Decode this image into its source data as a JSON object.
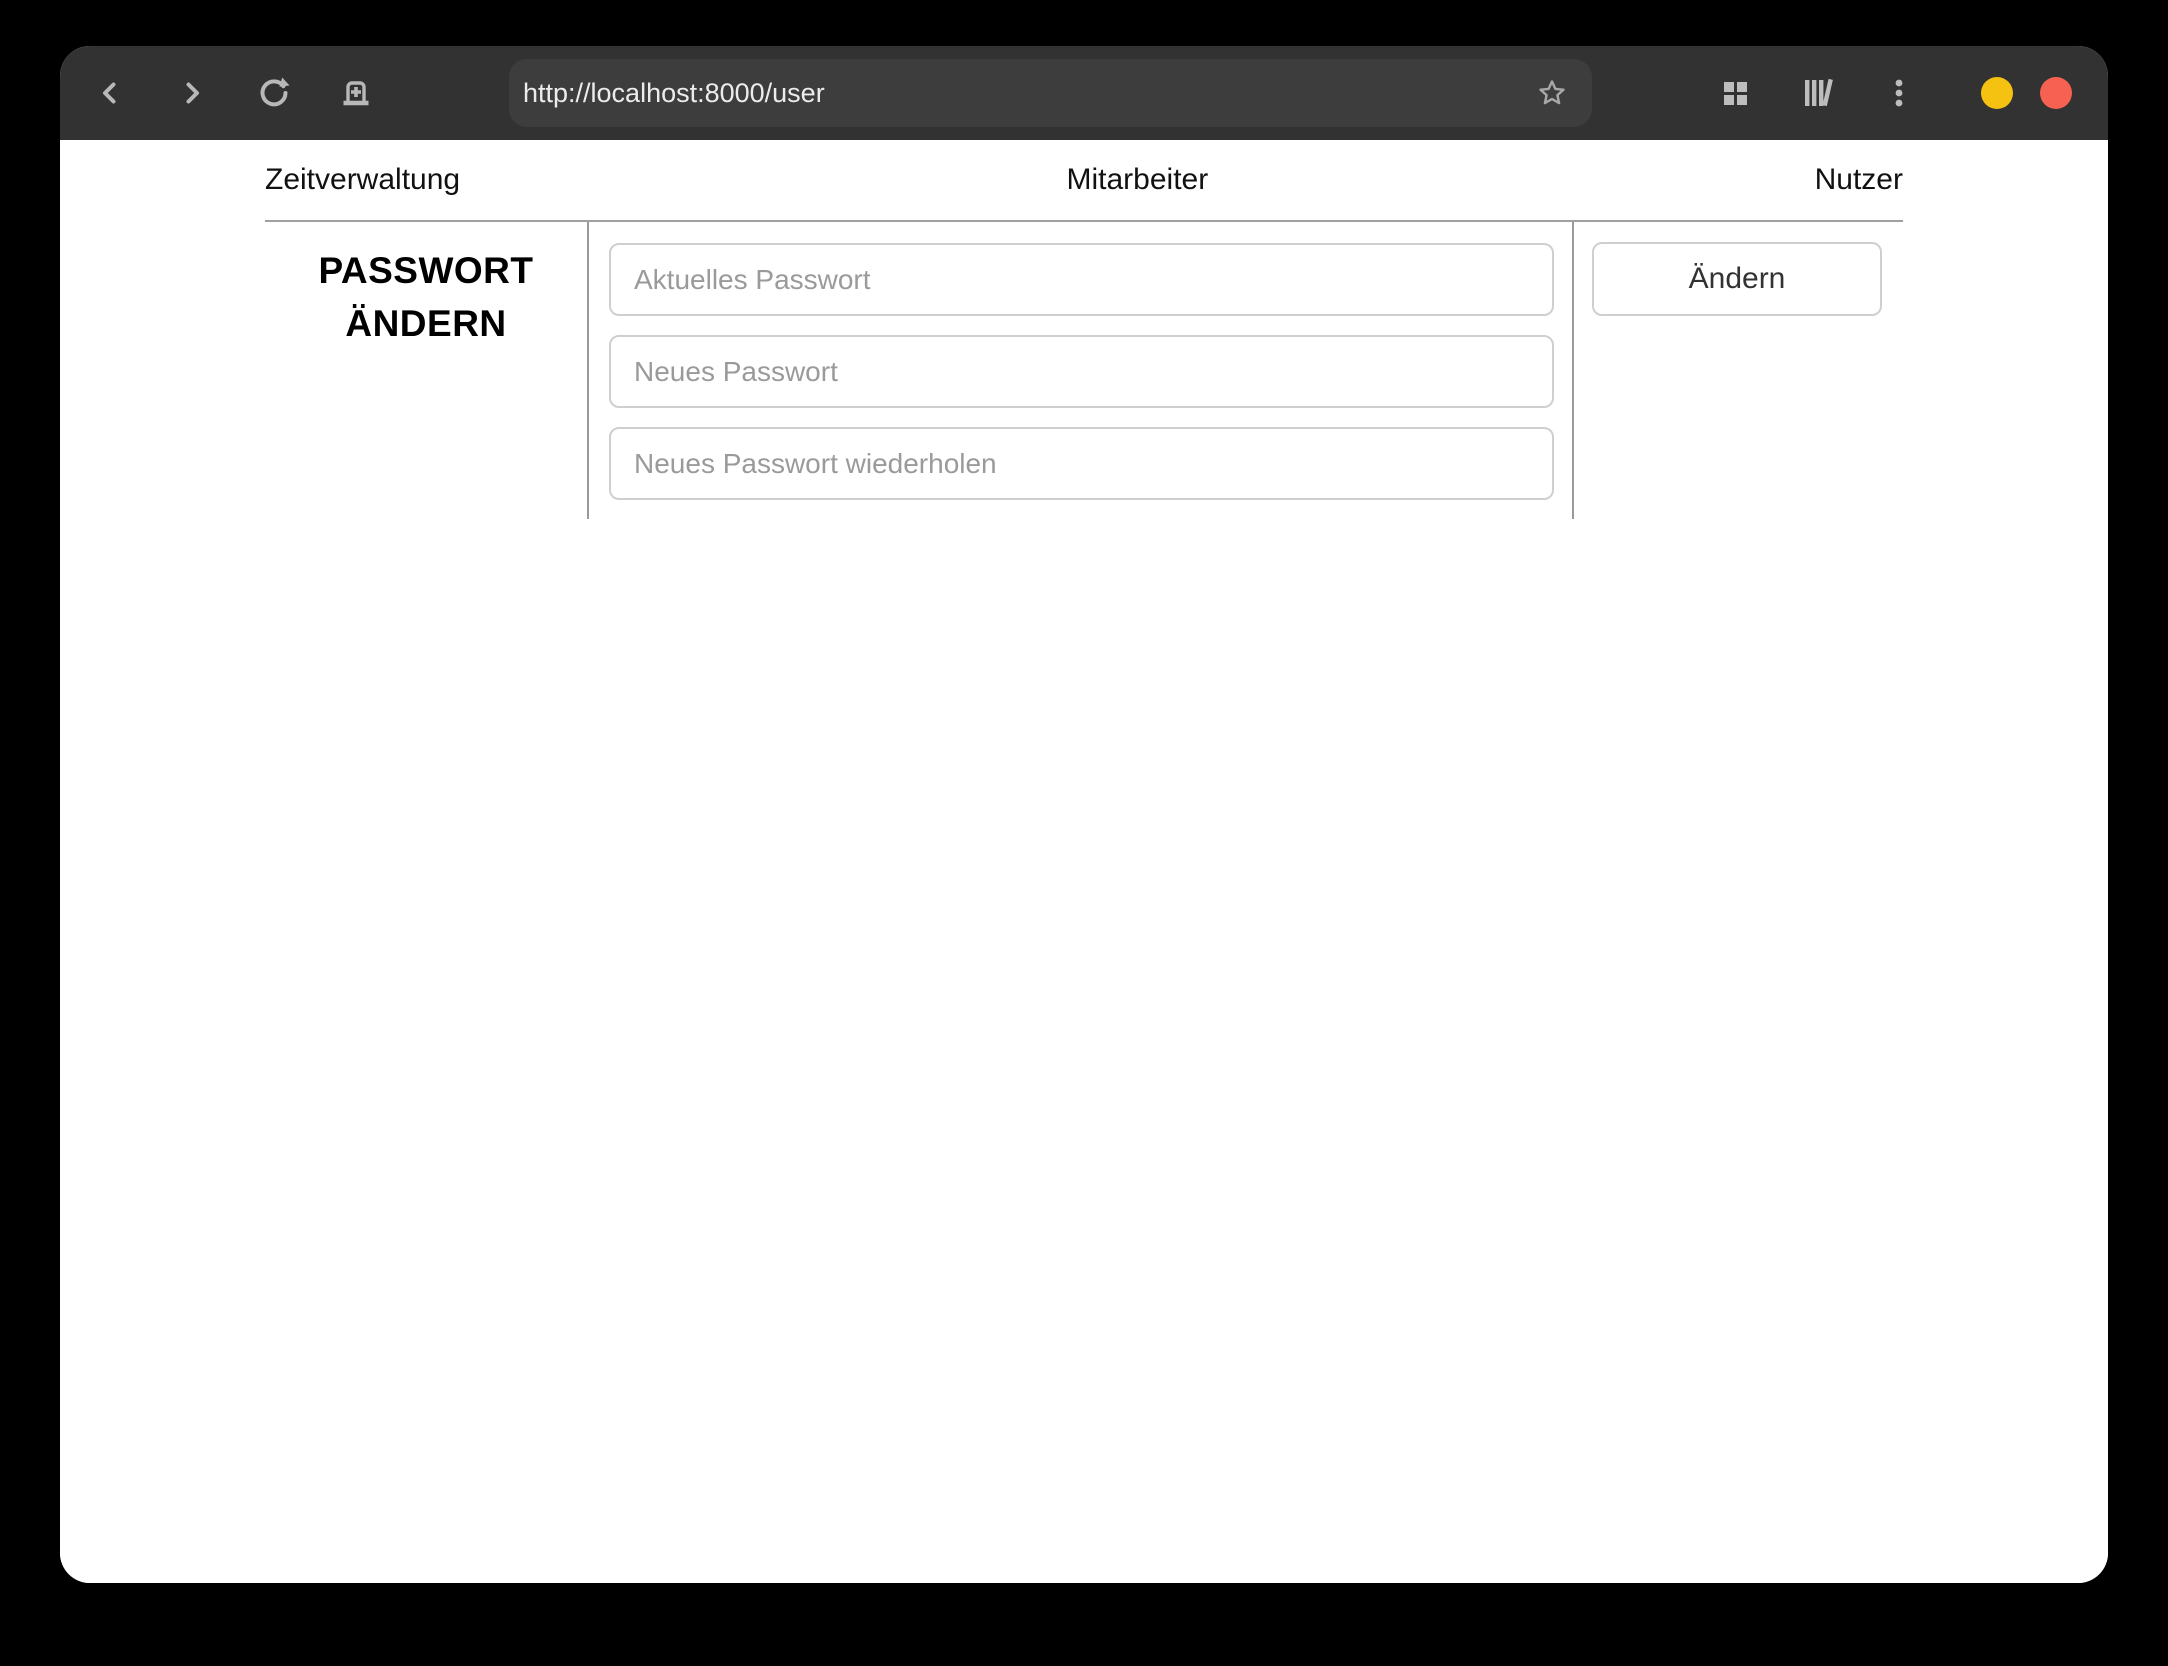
{
  "browser": {
    "url": "http://localhost:8000/user",
    "icons": {
      "back": "chevron-left",
      "forward": "chevron-right",
      "reload": "circular-arrow",
      "new_tab": "tab-with-plus",
      "bookmark": "star-outline",
      "tab_overview": "grid-2x2",
      "library": "books",
      "menu": "kebab-vertical-dots"
    },
    "window_controls": {
      "minimize_color": "#f5c211",
      "close_color": "#f66151"
    }
  },
  "page": {
    "nav": {
      "items": [
        {
          "label": "Zeitverwaltung"
        },
        {
          "label": "Mitarbeiter"
        },
        {
          "label": "Nutzer"
        }
      ]
    },
    "password_section": {
      "heading_line1": "PASSWORT",
      "heading_line2": "ÄNDERN",
      "fields": [
        {
          "placeholder": "Aktuelles Passwort",
          "value": ""
        },
        {
          "placeholder": "Neues Passwort",
          "value": ""
        },
        {
          "placeholder": "Neues Passwort wiederholen",
          "value": ""
        }
      ],
      "submit_label": "Ändern"
    }
  }
}
